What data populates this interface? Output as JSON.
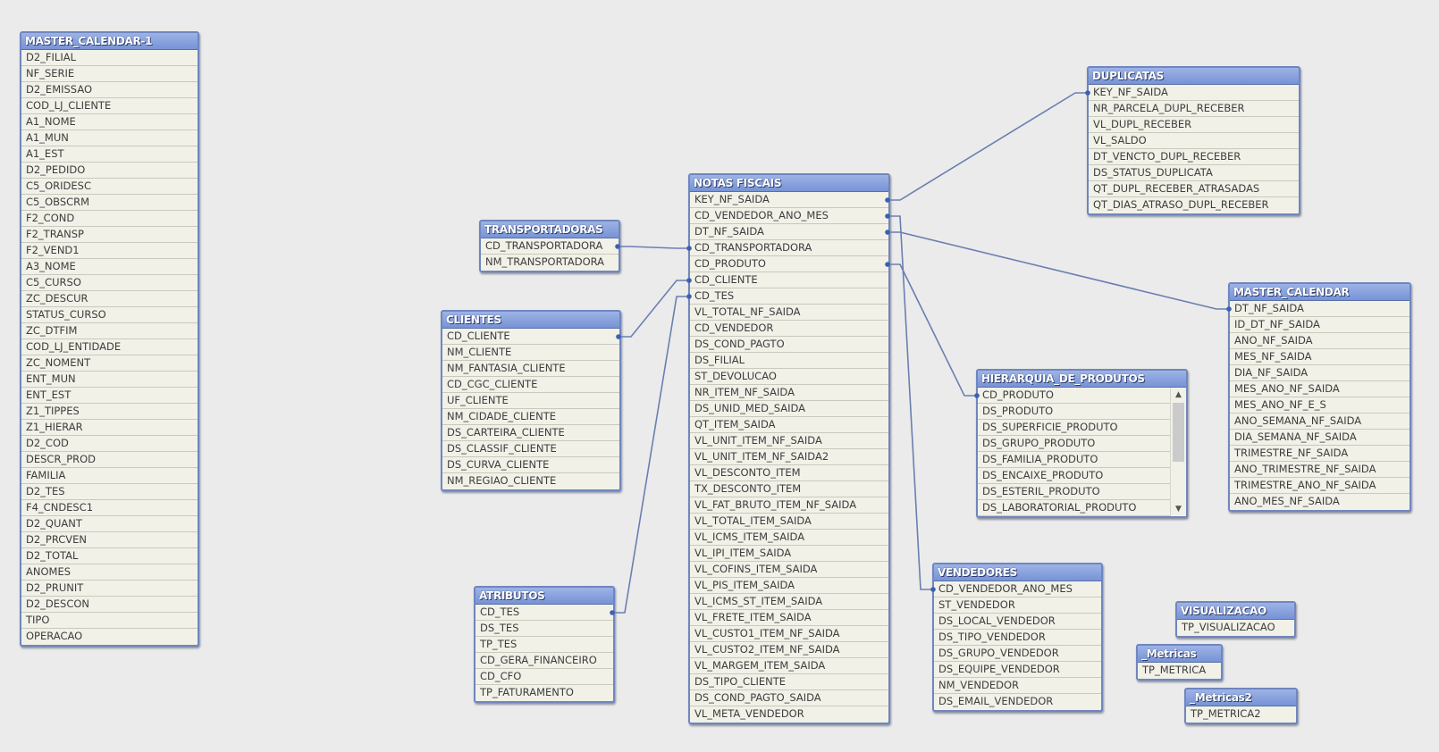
{
  "colors": {
    "background": "#ebebeb",
    "header": "#7f9bd8",
    "link": "#6a7fb0",
    "row": "#f1f1e8"
  },
  "tables": [
    {
      "id": "master_calendar_1",
      "title": "MASTER_CALENDAR-1",
      "fields": [
        "D2_FILIAL",
        "NF_SERIE",
        "D2_EMISSAO",
        "COD_LJ_CLIENTE",
        "A1_NOME",
        "A1_MUN",
        "A1_EST",
        "D2_PEDIDO",
        "C5_ORIDESC",
        "C5_OBSCRM",
        "F2_COND",
        "F2_TRANSP",
        "F2_VEND1",
        "A3_NOME",
        "C5_CURSO",
        "ZC_DESCUR",
        "STATUS_CURSO",
        "ZC_DTFIM",
        "COD_LJ_ENTIDADE",
        "ZC_NOMENT",
        "ENT_MUN",
        "ENT_EST",
        "Z1_TIPPES",
        "Z1_HIERAR",
        "D2_COD",
        "DESCR_PROD",
        "FAMILIA",
        "D2_TES",
        "F4_CNDESC1",
        "D2_QUANT",
        "D2_PRCVEN",
        "D2_TOTAL",
        "ANOMES",
        "D2_PRUNIT",
        "D2_DESCON",
        "TIPO",
        "OPERACAO"
      ]
    },
    {
      "id": "notas_fiscais",
      "title": "NOTAS FISCAIS",
      "fields": [
        "KEY_NF_SAIDA",
        "CD_VENDEDOR_ANO_MES",
        "DT_NF_SAIDA",
        "CD_TRANSPORTADORA",
        "CD_PRODUTO",
        "CD_CLIENTE",
        "CD_TES",
        "VL_TOTAL_NF_SAIDA",
        "CD_VENDEDOR",
        "DS_COND_PAGTO",
        "DS_FILIAL",
        "ST_DEVOLUCAO",
        "NR_ITEM_NF_SAIDA",
        "DS_UNID_MED_SAIDA",
        "QT_ITEM_SAIDA",
        "VL_UNIT_ITEM_NF_SAIDA",
        "VL_UNIT_ITEM_NF_SAIDA2",
        "VL_DESCONTO_ITEM",
        "TX_DESCONTO_ITEM",
        "VL_FAT_BRUTO_ITEM_NF_SAIDA",
        "VL_TOTAL_ITEM_SAIDA",
        "VL_ICMS_ITEM_SAIDA",
        "VL_IPI_ITEM_SAIDA",
        "VL_COFINS_ITEM_SAIDA",
        "VL_PIS_ITEM_SAIDA",
        "VL_ICMS_ST_ITEM_SAIDA",
        "VL_FRETE_ITEM_SAIDA",
        "VL_CUSTO1_ITEM_NF_SAIDA",
        "VL_CUSTO2_ITEM_NF_SAIDA",
        "VL_MARGEM_ITEM_SAIDA",
        "DS_TIPO_CLIENTE",
        "DS_COND_PAGTO_SAIDA",
        "VL_META_VENDEDOR"
      ]
    },
    {
      "id": "transportadoras",
      "title": "TRANSPORTADORAS",
      "fields": [
        "CD_TRANSPORTADORA",
        "NM_TRANSPORTADORA"
      ]
    },
    {
      "id": "clientes",
      "title": "CLIENTES",
      "fields": [
        "CD_CLIENTE",
        "NM_CLIENTE",
        "NM_FANTASIA_CLIENTE",
        "CD_CGC_CLIENTE",
        "UF_CLIENTE",
        "NM_CIDADE_CLIENTE",
        "DS_CARTEIRA_CLIENTE",
        "DS_CLASSIF_CLIENTE",
        "DS_CURVA_CLIENTE",
        "NM_REGIAO_CLIENTE"
      ]
    },
    {
      "id": "atributos",
      "title": "ATRIBUTOS",
      "fields": [
        "CD_TES",
        "DS_TES",
        "TP_TES",
        "CD_GERA_FINANCEIRO",
        "CD_CFO",
        "TP_FATURAMENTO"
      ]
    },
    {
      "id": "duplicatas",
      "title": "DUPLICATAS",
      "fields": [
        "KEY_NF_SAIDA",
        "NR_PARCELA_DUPL_RECEBER",
        "VL_DUPL_RECEBER",
        "VL_SALDO",
        "DT_VENCTO_DUPL_RECEBER",
        "DS_STATUS_DUPLICATA",
        "QT_DUPL_RECEBER_ATRASADAS",
        "QT_DIAS_ATRASO_DUPL_RECEBER"
      ]
    },
    {
      "id": "master_calendar",
      "title": "MASTER_CALENDAR",
      "fields": [
        "DT_NF_SAIDA",
        "ID_DT_NF_SAIDA",
        "ANO_NF_SAIDA",
        "MES_NF_SAIDA",
        "DIA_NF_SAIDA",
        "MES_ANO_NF_SAIDA",
        "MES_ANO_NF_E_S",
        "ANO_SEMANA_NF_SAIDA",
        "DIA_SEMANA_NF_SAIDA",
        "TRIMESTRE_NF_SAIDA",
        "ANO_TRIMESTRE_NF_SAIDA",
        "TRIMESTRE_ANO_NF_SAIDA",
        "ANO_MES_NF_SAIDA"
      ]
    },
    {
      "id": "hierarquia_de_produtos",
      "title": "HIERARQUIA_DE_PRODUTOS",
      "scrollable": true,
      "fields": [
        "CD_PRODUTO",
        "DS_PRODUTO",
        "DS_SUPERFICIE_PRODUTO",
        "DS_GRUPO_PRODUTO",
        "DS_FAMILIA_PRODUTO",
        "DS_ENCAIXE_PRODUTO",
        "DS_ESTERIL_PRODUTO",
        "DS_LABORATORIAL_PRODUTO"
      ]
    },
    {
      "id": "vendedores",
      "title": "VENDEDORES",
      "fields": [
        "CD_VENDEDOR_ANO_MES",
        "ST_VENDEDOR",
        "DS_LOCAL_VENDEDOR",
        "DS_TIPO_VENDEDOR",
        "DS_GRUPO_VENDEDOR",
        "DS_EQUIPE_VENDEDOR",
        "NM_VENDEDOR",
        "DS_EMAIL_VENDEDOR"
      ]
    },
    {
      "id": "visualizacao",
      "title": "VISUALIZACAO",
      "fields": [
        "TP_VISUALIZACAO"
      ]
    },
    {
      "id": "metricas",
      "title": "_Metricas",
      "fields": [
        "TP_METRICA"
      ]
    },
    {
      "id": "metricas2",
      "title": "_Metricas2",
      "fields": [
        "TP_METRICA2"
      ]
    }
  ],
  "links": [
    {
      "from": "notas_fiscais",
      "from_field": "KEY_NF_SAIDA",
      "to": "duplicatas",
      "to_field": "KEY_NF_SAIDA"
    },
    {
      "from": "notas_fiscais",
      "from_field": "CD_VENDEDOR_ANO_MES",
      "to": "vendedores",
      "to_field": "CD_VENDEDOR_ANO_MES"
    },
    {
      "from": "notas_fiscais",
      "from_field": "DT_NF_SAIDA",
      "to": "master_calendar",
      "to_field": "DT_NF_SAIDA"
    },
    {
      "from": "notas_fiscais",
      "from_field": "CD_PRODUTO",
      "to": "hierarquia_de_produtos",
      "to_field": "CD_PRODUTO"
    },
    {
      "from": "transportadoras",
      "from_field": "CD_TRANSPORTADORA",
      "to": "notas_fiscais",
      "to_field": "CD_TRANSPORTADORA"
    },
    {
      "from": "clientes",
      "from_field": "CD_CLIENTE",
      "to": "notas_fiscais",
      "to_field": "CD_CLIENTE"
    },
    {
      "from": "atributos",
      "from_field": "CD_TES",
      "to": "notas_fiscais",
      "to_field": "CD_TES"
    }
  ]
}
